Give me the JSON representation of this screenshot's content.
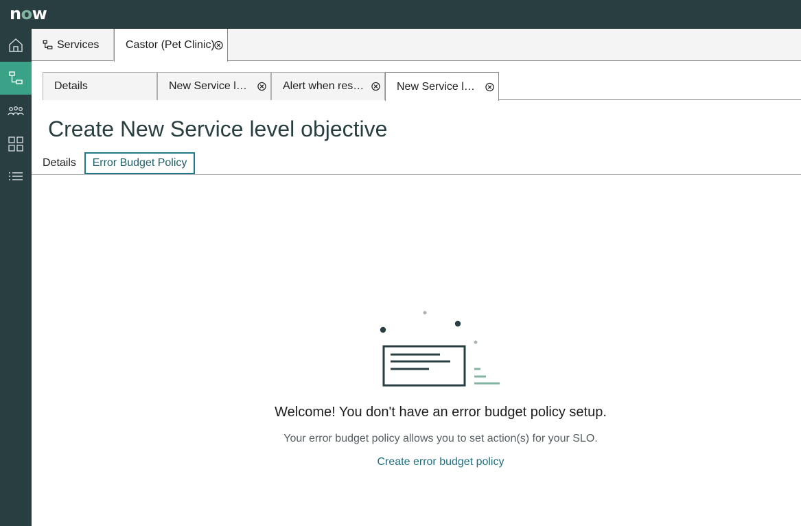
{
  "brand": {
    "logo_text_n": "n",
    "logo_text_o": "o",
    "logo_text_w": "w"
  },
  "sidenav": {
    "items": [
      {
        "name": "home",
        "icon": "home-icon",
        "active": false
      },
      {
        "name": "services",
        "icon": "service-map-icon",
        "active": true
      },
      {
        "name": "teams",
        "icon": "people-icon",
        "active": false
      },
      {
        "name": "dashboards",
        "icon": "grid-icon",
        "active": false
      },
      {
        "name": "list",
        "icon": "list-icon",
        "active": false
      }
    ]
  },
  "app_tabs": [
    {
      "label": "Services",
      "icon": "service-map-icon"
    },
    {
      "label": "Castor (Pet Clinic)",
      "closable": true
    }
  ],
  "record_tabs": [
    {
      "label": "Details"
    },
    {
      "label": "New Service level objective",
      "display": "New Service lev…",
      "closable": true
    },
    {
      "label": "Alert when response",
      "display": "Alert when resp…",
      "closable": true
    },
    {
      "label": "New Service level objective",
      "display": "New Service lev…",
      "closable": true
    }
  ],
  "page": {
    "title": "Create New Service level objective"
  },
  "form_tabs": [
    {
      "label": "Details"
    },
    {
      "label": "Error Budget Policy",
      "selected": true
    }
  ],
  "empty_state": {
    "title": "Welcome! You don't have an error budget policy setup.",
    "subtitle": "Your error budget policy allows you to set action(s) for your SLO.",
    "link": "Create error budget policy"
  },
  "colors": {
    "topbar": "#293e40",
    "nav_active": "#3aa287",
    "accent": "#1f7a87",
    "link": "#1f6f80"
  }
}
